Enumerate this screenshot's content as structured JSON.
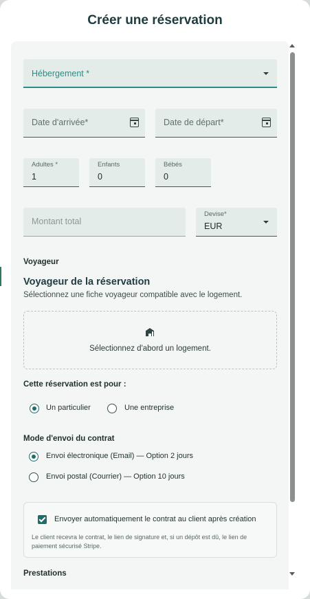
{
  "modal": {
    "title": "Créer une réservation"
  },
  "form": {
    "accommodation": {
      "placeholder": "Hébergement *"
    },
    "arrival_date": {
      "placeholder": "Date d'arrivée*"
    },
    "departure_date": {
      "placeholder": "Date de départ*"
    },
    "adults": {
      "label": "Adultes *",
      "value": "1"
    },
    "children": {
      "label": "Enfants",
      "value": "0"
    },
    "babies": {
      "label": "Bébés",
      "value": "0"
    },
    "total_amount": {
      "placeholder": "Montant total"
    },
    "currency": {
      "label": "Devise*",
      "value": "EUR"
    }
  },
  "traveler": {
    "section_label": "Voyageur",
    "heading": "Voyageur de la réservation",
    "description": "Sélectionnez une fiche voyageur compatible avec le logement.",
    "empty_message": "Sélectionnez d'abord un logement."
  },
  "booking_for": {
    "label": "Cette réservation est pour :",
    "options": [
      "Un particulier",
      "Une entreprise"
    ],
    "selected": "Un particulier"
  },
  "contract_mode": {
    "label": "Mode d'envoi du contrat",
    "options": [
      "Envoi électronique (Email) — Option 2 jours",
      "Envoi postal (Courrier) — Option 10 jours"
    ],
    "selected": "Envoi électronique (Email) — Option 2 jours"
  },
  "auto_send": {
    "checked": true,
    "label": "Envoyer automatiquement le contrat au client après création",
    "help_line1": "Le client recevra le contrat, le lien de signature et, si un dépôt est dû, le lien de",
    "help_line2": "paiement sécurisé Stripe."
  },
  "services": {
    "section_label": "Prestations"
  },
  "colors": {
    "accent": "#1f6d69",
    "title": "#1e3c40",
    "field_bg": "#e4ecea"
  },
  "icons": {
    "accommodation": "building-icon",
    "calendar": "calendar-icon",
    "dropdown": "chevron-down-icon"
  }
}
